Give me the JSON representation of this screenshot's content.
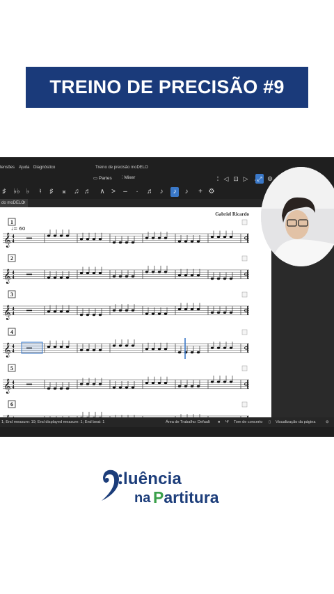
{
  "banner": {
    "title": "TREINO DE PRECISÃO #9"
  },
  "menubar": {
    "items": [
      "tensões",
      "Ajuda",
      "Diagnóstico"
    ],
    "window_title": "Treino de precisão moDELO"
  },
  "toolbar": {
    "parts_label": "Partes",
    "mixer_label": "Mixer",
    "right_icons": [
      "grip-icon",
      "rewind-icon",
      "loop-icon",
      "play-icon",
      "metronome-icon",
      "flip-icon",
      "settings-icon"
    ]
  },
  "note_input": {
    "icons": [
      "sharp",
      "double-flat",
      "flat",
      "natural",
      "sharp",
      "double-sharp",
      "beam-group",
      "tuplet",
      "accent",
      "marcato",
      "tenuto",
      "staccato",
      "beam-16th",
      "beam-8th",
      "voice-1",
      "voice-2",
      "add",
      "settings"
    ]
  },
  "tab": {
    "label": "do moDELO",
    "close": "✕"
  },
  "score": {
    "composer": "Gabriel Ricardo",
    "tempo": "= 60",
    "systems": [
      "1",
      "2",
      "3",
      "4",
      "5",
      "6"
    ],
    "time_signature": "4/4"
  },
  "status": {
    "position": "1; End measure: 19; End displayed measure: 1; End beat: 1",
    "workspace": "Área de Trabalho: Default",
    "concert_pitch": "Tom de concerto",
    "page_view": "Visualização da página"
  },
  "brand": {
    "line1": "luência",
    "line2a": "na",
    "line2b": "Partitura"
  },
  "colors": {
    "banner_bg": "#1a3a7a",
    "brand_blue": "#1c3d7a",
    "brand_green": "#3aa04a",
    "accent_blue": "#3a78c8"
  }
}
